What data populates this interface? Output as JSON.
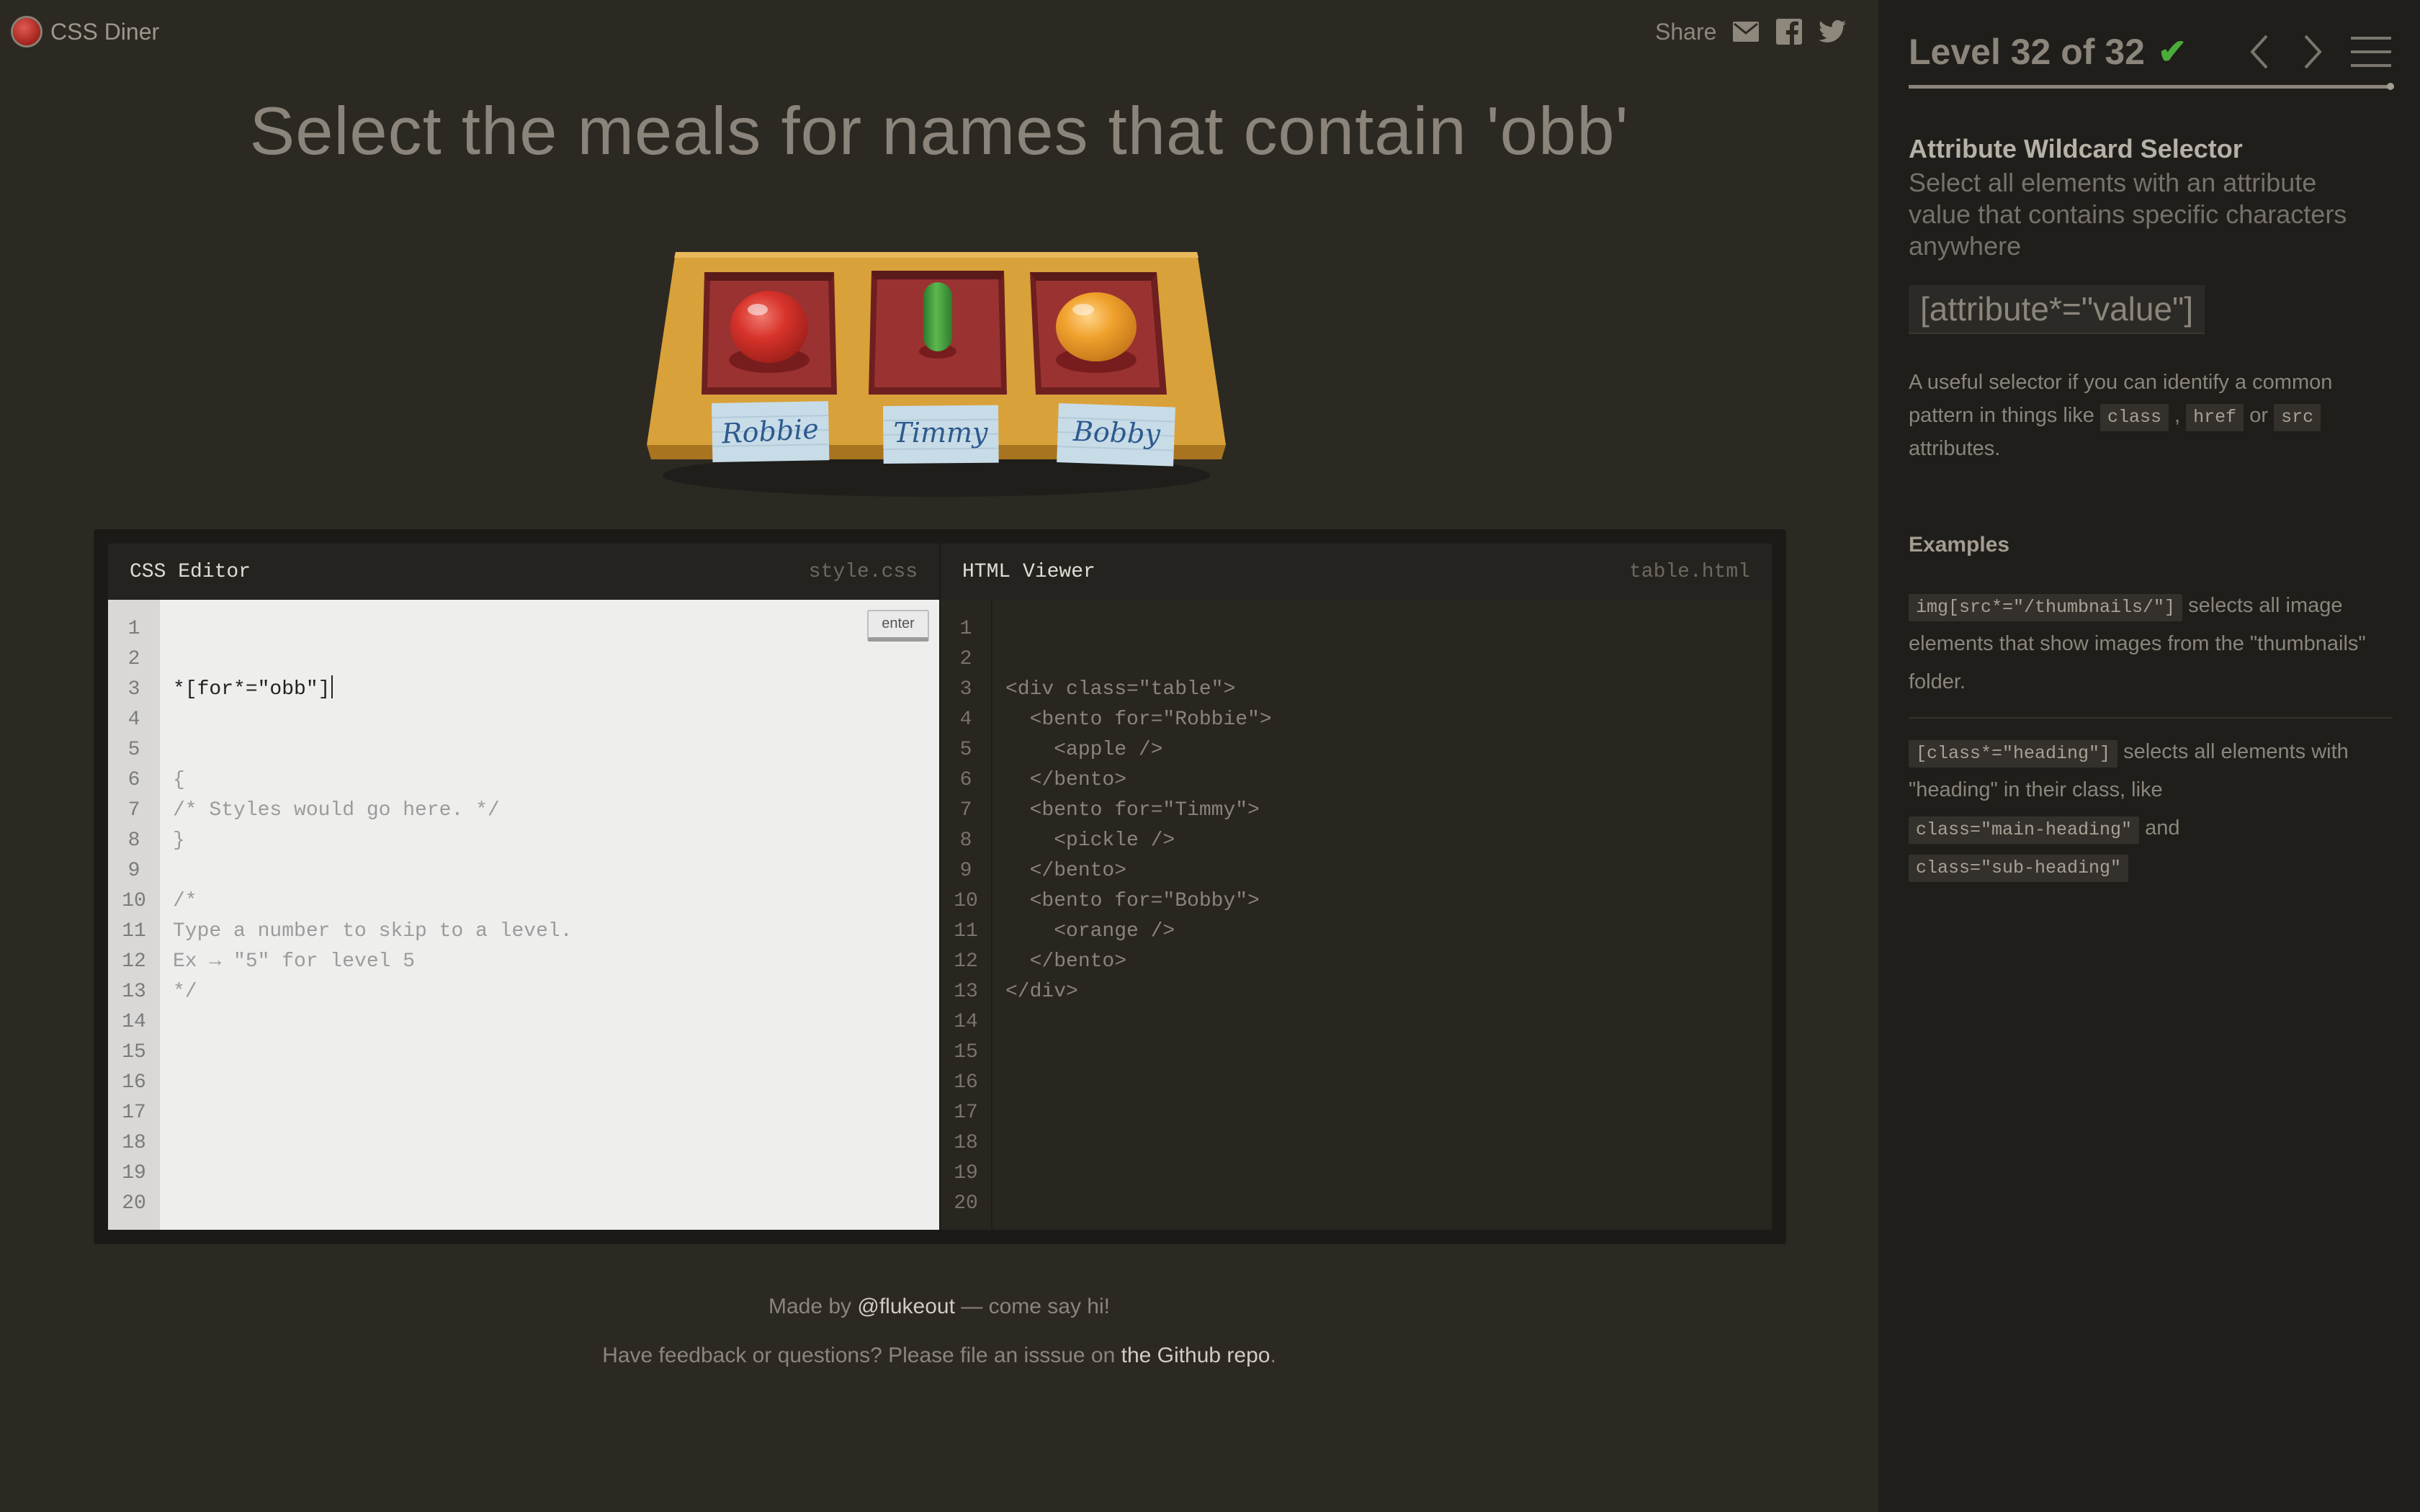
{
  "header": {
    "app_name": "CSS Diner",
    "share_label": "Share",
    "share_icons": [
      "mail-icon",
      "facebook-icon",
      "twitter-icon"
    ]
  },
  "instruction": "Select the meals for names that contain 'obb'",
  "table": {
    "bentos": [
      {
        "name": "Robbie",
        "item": "apple",
        "item_color": "#d7332b"
      },
      {
        "name": "Timmy",
        "item": "pickle",
        "item_color": "#3d9a3a"
      },
      {
        "name": "Bobby",
        "item": "orange",
        "item_color": "#f0a12c"
      }
    ]
  },
  "css_editor": {
    "title": "CSS Editor",
    "filename": "style.css",
    "input_value": "*[for*=\"obb\"]",
    "enter_label": "enter",
    "lines": [
      "{",
      "/* Styles would go here. */",
      "}",
      "",
      "/*",
      "Type a number to skip to a level.",
      "Ex → \"5\" for level 5",
      "*/"
    ],
    "line_numbers": [
      "1",
      "2",
      "3",
      "4",
      "5",
      "6",
      "7",
      "8",
      "9",
      "10",
      "11",
      "12",
      "13",
      "14",
      "15",
      "16",
      "17",
      "18",
      "19",
      "20"
    ]
  },
  "html_viewer": {
    "title": "HTML Viewer",
    "filename": "table.html",
    "lines": [
      "<div class=\"table\">",
      "  <bento for=\"Robbie\">",
      "    <apple />",
      "  </bento>",
      "  <bento for=\"Timmy\">",
      "    <pickle />",
      "  </bento>",
      "  <bento for=\"Bobby\">",
      "    <orange />",
      "  </bento>",
      "</div>"
    ],
    "line_numbers": [
      "1",
      "2",
      "3",
      "4",
      "5",
      "6",
      "7",
      "8",
      "9",
      "10",
      "11",
      "12",
      "13",
      "14",
      "15",
      "16",
      "17",
      "18",
      "19",
      "20"
    ]
  },
  "footer": {
    "line1_prefix": "Made by ",
    "line1_link": "@flukeout",
    "line1_suffix": " — come say hi!",
    "line2_prefix": "Have feedback or questions? Please file an isssue on ",
    "line2_link": "the Github repo",
    "line2_suffix": "."
  },
  "sidebar": {
    "level_label": "Level 32 of 32",
    "level_current": 32,
    "level_total": 32,
    "completed": true,
    "selector_name": "Attribute Wildcard Selector",
    "selector_desc": "Select all elements with an attribute value that contains specific characters anywhere",
    "syntax": "[attribute*=\"value\"]",
    "hint_prefix": "A useful selector if you can identify a common pattern in things like ",
    "hint_chip1": "class",
    "hint_sep1": " , ",
    "hint_chip2": "href",
    "hint_sep2": " or ",
    "hint_chip3": "src",
    "hint_suffix": " attributes.",
    "examples_title": "Examples",
    "example1_code": "img[src*=\"/thumbnails/\"]",
    "example1_text": " selects all image elements that show images from the \"thumbnails\" folder.",
    "example2_code": "[class*=\"heading\"]",
    "example2_text1": " selects all elements with \"heading\" in their class, like ",
    "example2_code2": "class=\"main-heading\"",
    "example2_text2": " and ",
    "example2_code3": "class=\"sub-heading\""
  },
  "colors": {
    "background": "#2c2923",
    "sidebar": "#1f1e1b",
    "check": "#4bab3b",
    "table_wood": "#d9a13a",
    "bento_red": "#9b3232",
    "label_paper": "#c8dce8",
    "label_ink": "#2d5a8e"
  }
}
